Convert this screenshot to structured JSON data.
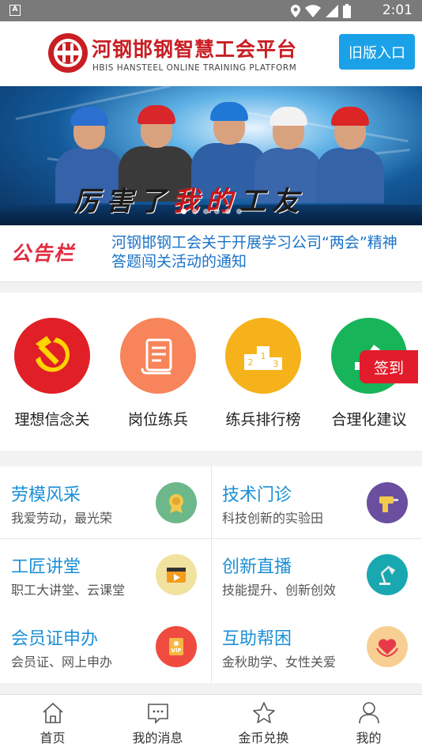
{
  "status_bar": {
    "time": "2:01"
  },
  "header": {
    "title": "河钢邯钢智慧工会平台",
    "subtitle": "HBIS HANSTEEL ONLINE TRAINING PLATFORM",
    "old_version_button": "旧版入口"
  },
  "banner": {
    "slogan_part1": "厉害了",
    "slogan_part2": "我的",
    "slogan_part3": "工友",
    "slide_count": 6,
    "active_slide": 1
  },
  "notice": {
    "label": "公告栏",
    "text": "河钢邯钢工会关于开展学习公司“两会”精神答题闯关活动的通知"
  },
  "quick_links": [
    {
      "label": "理想信念关",
      "icon": "hammer-sickle-icon",
      "color": "#e01f26"
    },
    {
      "label": "岗位练兵",
      "icon": "scroll-icon",
      "color": "#f7845a"
    },
    {
      "label": "练兵排行榜",
      "icon": "podium-icon",
      "color": "#f6b21b"
    },
    {
      "label": "合理化建议",
      "icon": "pencil-icon",
      "color": "#17b45a"
    }
  ],
  "signin_button": "签到",
  "grid_items": [
    {
      "title": "劳模风采",
      "subtitle": "我爱劳动，最光荣",
      "icon": "medal-icon",
      "color": "#6db88a"
    },
    {
      "title": "技术门诊",
      "subtitle": "科技创新的实验田",
      "icon": "drill-icon",
      "color": "#6a4fa0"
    },
    {
      "title": "工匠讲堂",
      "subtitle": "职工大讲堂、云课堂",
      "icon": "video-icon",
      "color": "#f2e2a0"
    },
    {
      "title": "创新直播",
      "subtitle": "技能提升、创新创效",
      "icon": "lamp-icon",
      "color": "#1aa8b0"
    },
    {
      "title": "会员证申办",
      "subtitle": "会员证、网上申办",
      "icon": "vip-card-icon",
      "color": "#ef4b3f"
    },
    {
      "title": "互助帮困",
      "subtitle": "金秋助学、女性关爱",
      "icon": "heart-hands-icon",
      "color": "#f7cf92"
    }
  ],
  "tabs": [
    {
      "label": "首页",
      "icon": "home-icon"
    },
    {
      "label": "我的消息",
      "icon": "message-icon"
    },
    {
      "label": "金币兑换",
      "icon": "star-icon"
    },
    {
      "label": "我的",
      "icon": "user-icon"
    }
  ]
}
